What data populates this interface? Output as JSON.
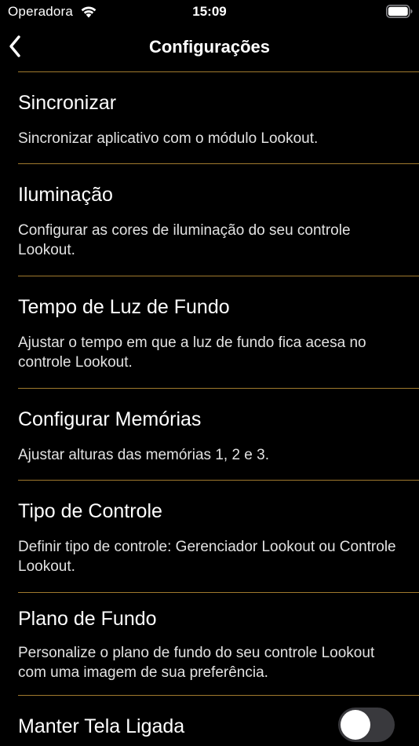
{
  "status_bar": {
    "carrier": "Operadora",
    "time": "15:09",
    "wifi_icon": "wifi-icon",
    "battery_icon": "battery-icon"
  },
  "nav": {
    "title": "Configurações",
    "back_icon": "chevron-left-icon"
  },
  "settings": [
    {
      "title": "Sincronizar",
      "description": "Sincronizar aplicativo com o módulo Lookout."
    },
    {
      "title": "Iluminação",
      "description": "Configurar as cores de iluminação do seu controle Lookout."
    },
    {
      "title": "Tempo de Luz de Fundo",
      "description": "Ajustar o tempo em que a luz de fundo fica acesa no controle Lookout."
    },
    {
      "title": "Configurar Memórias",
      "description": "Ajustar alturas das memórias 1, 2 e 3."
    },
    {
      "title": "Tipo de Controle",
      "description": "Definir tipo de controle: Gerenciador Lookout ou Controle Lookout."
    },
    {
      "title": "Plano de Fundo",
      "description": "Personalize o plano de fundo do seu controle Lookout com uma imagem de sua preferência."
    },
    {
      "title": "Manter Tela Ligada",
      "toggle_on": false
    }
  ],
  "colors": {
    "background": "#000000",
    "divider": "#a07a2e",
    "toggle_off": "#39393d"
  }
}
